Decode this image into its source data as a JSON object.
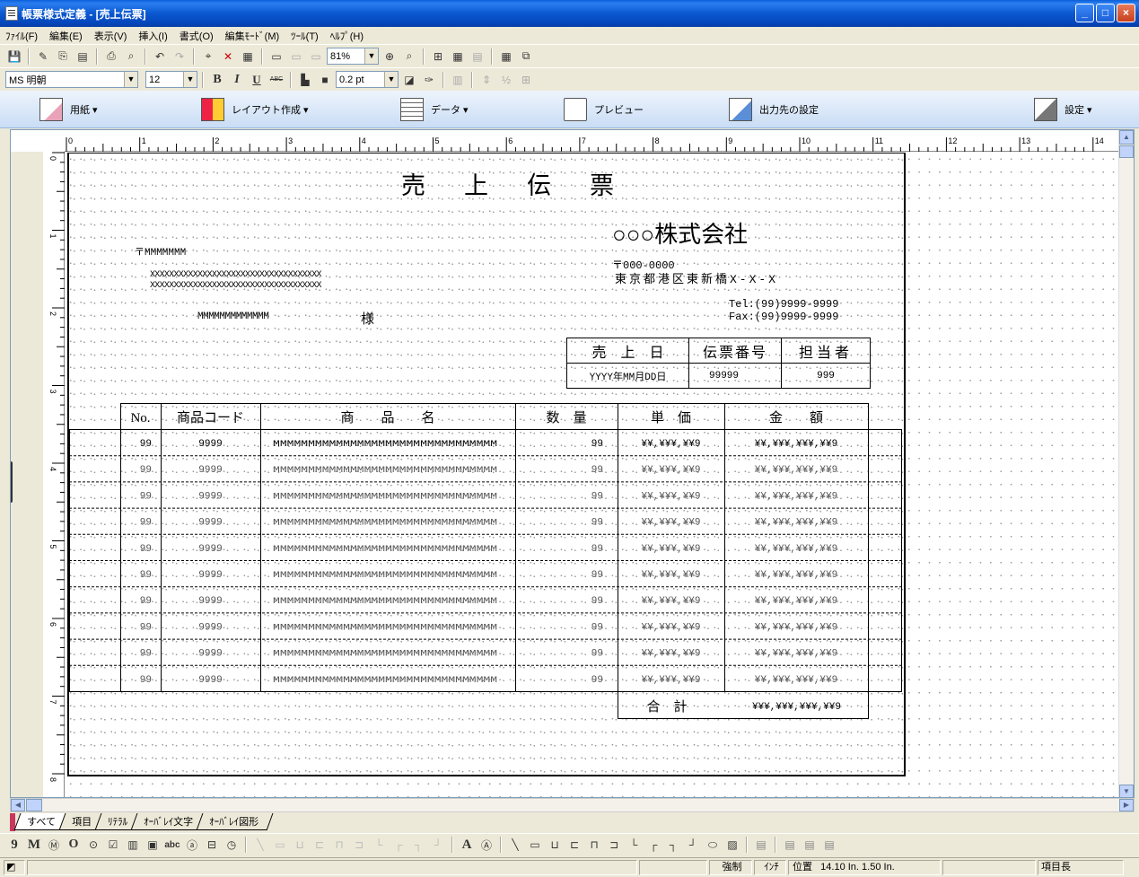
{
  "window": {
    "title": "帳票様式定義 - [売上伝票]",
    "buttons": {
      "minimize": "_",
      "maximize": "□",
      "close": "×"
    }
  },
  "menu": [
    "ﾌｧｲﾙ(F)",
    "編集(E)",
    "表示(V)",
    "挿入(I)",
    "書式(O)",
    "編集ﾓｰﾄﾞ(M)",
    "ﾂｰﾙ(T)",
    "ﾍﾙﾌﾟ(H)"
  ],
  "toolbar": {
    "zoom": "81%",
    "font_name": "MS 明朝",
    "font_size": "12",
    "line_width": "0.2 pt",
    "bold": "B",
    "italic": "I",
    "underline": "U",
    "strike": "ABC"
  },
  "ribbon": {
    "paper": "用紙 ▾",
    "layout": "レイアウト作成 ▾",
    "data": "データ ▾",
    "preview": "プレビュー",
    "output": "出力先の設定",
    "settings": "設定 ▾"
  },
  "ruler": {
    "h_labels": [
      "0",
      "1",
      "2",
      "3",
      "4",
      "5",
      "6",
      "7",
      "8",
      "9",
      "10",
      "11",
      "12",
      "13",
      "14"
    ],
    "v_labels": [
      "0",
      "1",
      "2",
      "3",
      "4",
      "5",
      "6",
      "7",
      "8"
    ]
  },
  "form": {
    "title": "売　上　伝　票",
    "company": "○○○株式会社",
    "postal_label": "〒MMMMMMM",
    "address_line1": "XXXXXXXXXXXXXXXXXXXXXXXXXXXXXXXXXXXX",
    "address_line2": "XXXXXXXXXXXXXXXXXXXXXXXXXXXXXXXXXXXX",
    "recipient": "MMMMMMMMMMMMM",
    "honorific": "様",
    "company_postal": "〒000-0000",
    "company_address": "東京都港区東新橋X-X-X",
    "tel": "Tel:(99)9999-9999",
    "fax": "Fax:(99)9999-9999",
    "header_cols": [
      "売　上　日",
      "伝票番号",
      "担当者"
    ],
    "header_vals": [
      "YYYY年MM月DD日",
      "99999",
      "999"
    ],
    "detail_cols": [
      "No.",
      "商品コード",
      "商　　品　　名",
      "数　量",
      "単　価",
      "金　　額"
    ],
    "rows": [
      {
        "no": "99",
        "code": "9999",
        "name": "MMMMMMMMMMMMMMMMMMMMMMMMMMMMMMMM",
        "qty": "99",
        "price": "¥¥,¥¥¥,¥¥9",
        "amount": "¥¥,¥¥¥,¥¥¥,¥¥9"
      },
      {
        "no": "99",
        "code": "9999",
        "name": "MMMMMMMMMMMMMMMMMMMMMMMMMMMMMMMM",
        "qty": "99",
        "price": "¥¥,¥¥¥,¥¥9",
        "amount": "¥¥,¥¥¥,¥¥¥,¥¥9"
      },
      {
        "no": "99",
        "code": "9999",
        "name": "MMMMMMMMMMMMMMMMMMMMMMMMMMMMMMMM",
        "qty": "99",
        "price": "¥¥,¥¥¥,¥¥9",
        "amount": "¥¥,¥¥¥,¥¥¥,¥¥9"
      },
      {
        "no": "99",
        "code": "9999",
        "name": "MMMMMMMMMMMMMMMMMMMMMMMMMMMMMMMM",
        "qty": "99",
        "price": "¥¥,¥¥¥,¥¥9",
        "amount": "¥¥,¥¥¥,¥¥¥,¥¥9"
      },
      {
        "no": "99",
        "code": "9999",
        "name": "MMMMMMMMMMMMMMMMMMMMMMMMMMMMMMMM",
        "qty": "99",
        "price": "¥¥,¥¥¥,¥¥9",
        "amount": "¥¥,¥¥¥,¥¥¥,¥¥9"
      },
      {
        "no": "99",
        "code": "9999",
        "name": "MMMMMMMMMMMMMMMMMMMMMMMMMMMMMMMM",
        "qty": "99",
        "price": "¥¥,¥¥¥,¥¥9",
        "amount": "¥¥,¥¥¥,¥¥¥,¥¥9"
      },
      {
        "no": "99",
        "code": "9999",
        "name": "MMMMMMMMMMMMMMMMMMMMMMMMMMMMMMMM",
        "qty": "99",
        "price": "¥¥,¥¥¥,¥¥9",
        "amount": "¥¥,¥¥¥,¥¥¥,¥¥9"
      },
      {
        "no": "99",
        "code": "9999",
        "name": "MMMMMMMMMMMMMMMMMMMMMMMMMMMMMMMM",
        "qty": "99",
        "price": "¥¥,¥¥¥,¥¥9",
        "amount": "¥¥,¥¥¥,¥¥¥,¥¥9"
      },
      {
        "no": "99",
        "code": "9999",
        "name": "MMMMMMMMMMMMMMMMMMMMMMMMMMMMMMMM",
        "qty": "99",
        "price": "¥¥,¥¥¥,¥¥9",
        "amount": "¥¥,¥¥¥,¥¥¥,¥¥9"
      },
      {
        "no": "99",
        "code": "9999",
        "name": "MMMMMMMMMMMMMMMMMMMMMMMMMMMMMMMM",
        "qty": "99",
        "price": "¥¥,¥¥¥,¥¥9",
        "amount": "¥¥,¥¥¥,¥¥¥,¥¥9"
      }
    ],
    "total_label": "合　計",
    "total_value": "¥¥¥,¥¥¥,¥¥¥,¥¥9"
  },
  "tabs": [
    "すべて",
    "項目",
    "ﾘﾃﾗﾙ",
    "ｵｰﾊﾞﾚｲ文字",
    "ｵｰﾊﾞﾚｲ図形"
  ],
  "status": {
    "mode": "強制",
    "unit": "ｲﾝﾁ",
    "position_label": "位置",
    "position_value": "14.10 In.   1.50 In.",
    "length_label": "項目長"
  }
}
